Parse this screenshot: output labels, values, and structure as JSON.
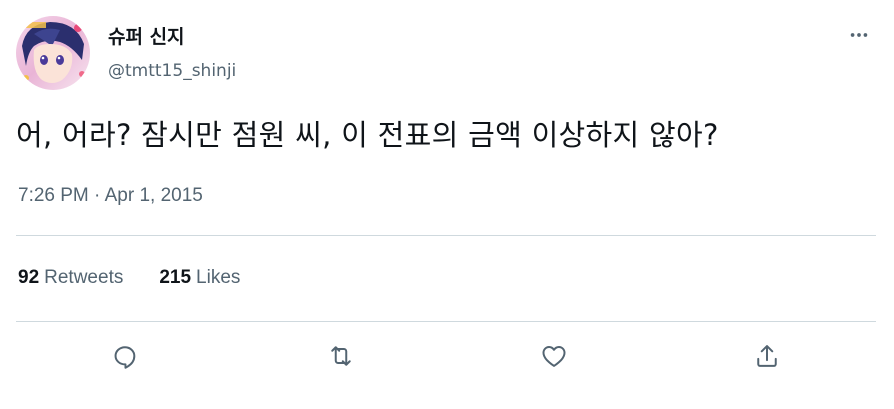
{
  "author": {
    "display_name": "슈퍼 신지",
    "handle": "@tmtt15_shinji",
    "avatar_alt": "profile avatar"
  },
  "tweet": {
    "text": "어, 어라? 잠시만 점원 씨, 이 전표의 금액 이상하지 않아?",
    "timestamp": "7:26 PM · Apr 1, 2015"
  },
  "stats": {
    "retweets_count": "92",
    "retweets_label": "Retweets",
    "likes_count": "215",
    "likes_label": "Likes"
  },
  "icons": {
    "more": "more-dots-icon",
    "reply": "reply-icon",
    "retweet": "retweet-icon",
    "like": "heart-icon",
    "share": "share-icon"
  },
  "colors": {
    "text_primary": "#0f1419",
    "text_secondary": "#536471",
    "divider": "#cfd9de"
  }
}
